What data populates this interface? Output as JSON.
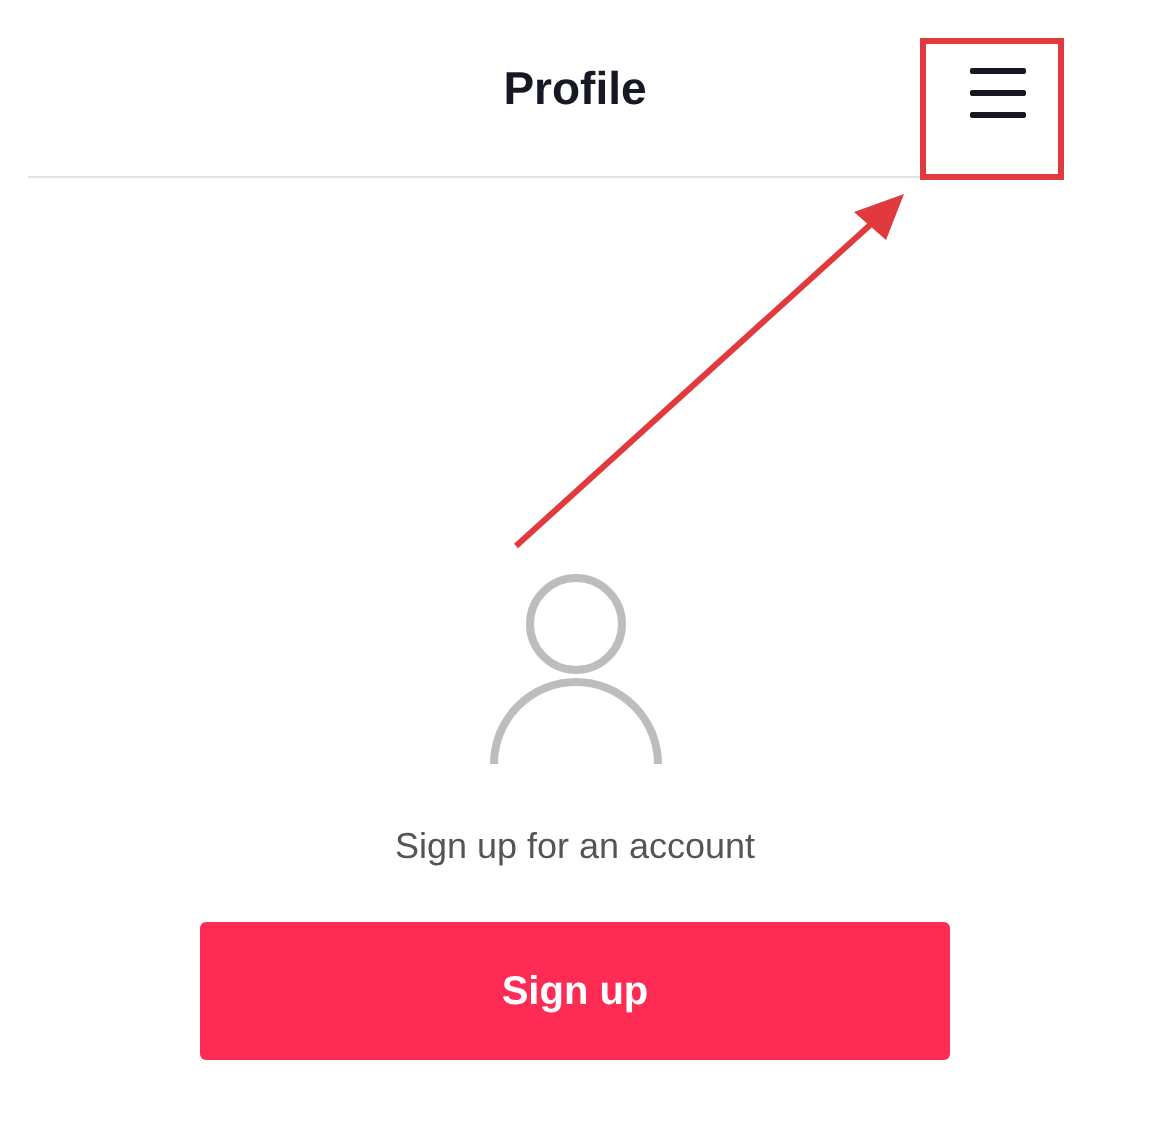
{
  "header": {
    "title": "Profile"
  },
  "prompt": "Sign up for an account",
  "button": "Sign up"
}
